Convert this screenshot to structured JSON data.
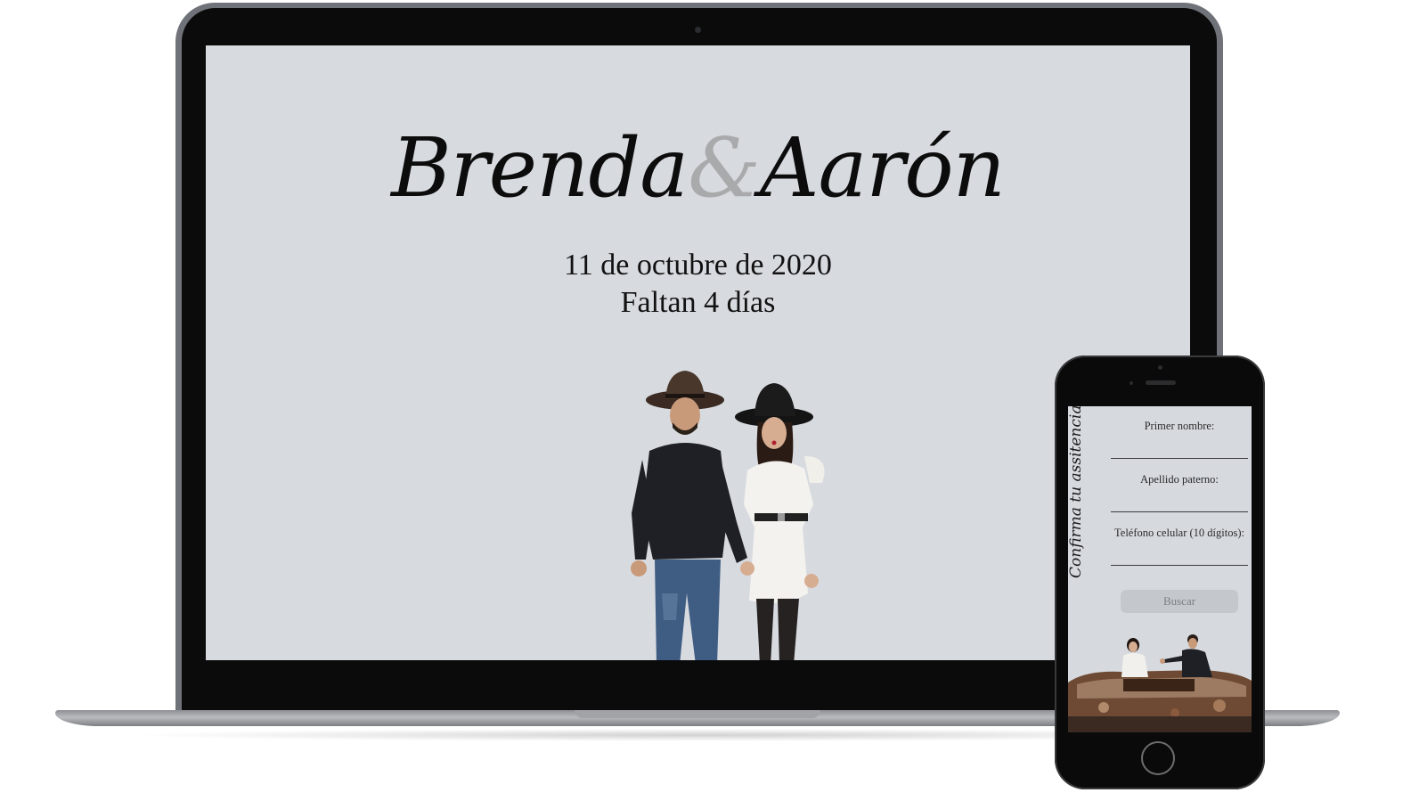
{
  "desktop_site": {
    "names": {
      "first": "Brenda",
      "ampersand": "&",
      "second": "Aarón"
    },
    "date": "11 de octubre de 2020",
    "countdown": "Faltan 4 días"
  },
  "mobile_site": {
    "rsvp_title": "Confirma tu assitencia",
    "fields": [
      {
        "label": "Primer nombre:",
        "value": ""
      },
      {
        "label": "Apellido paterno:",
        "value": ""
      },
      {
        "label": "Teléfono celular (10 dígitos):",
        "value": ""
      }
    ],
    "search_button": "Buscar"
  },
  "colors": {
    "screen_bg": "#d7dbe0",
    "ampersand": "#a9aaab",
    "button_bg": "#c4c7cb"
  }
}
